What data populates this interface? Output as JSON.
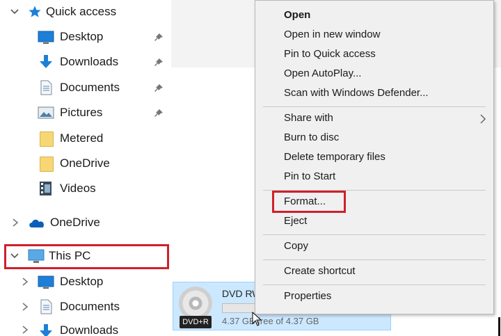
{
  "nav": {
    "quick_access": {
      "label": "Quick access",
      "items": [
        {
          "label": "Desktop",
          "icon": "desktop-icon",
          "pinned": true
        },
        {
          "label": "Downloads",
          "icon": "download-arrow-icon",
          "pinned": true
        },
        {
          "label": "Documents",
          "icon": "document-icon",
          "pinned": true
        },
        {
          "label": "Pictures",
          "icon": "pictures-icon",
          "pinned": true
        },
        {
          "label": "Metered",
          "icon": "folder-icon",
          "pinned": false
        },
        {
          "label": "OneDrive",
          "icon": "folder-icon",
          "pinned": false
        },
        {
          "label": "Videos",
          "icon": "videos-icon",
          "pinned": false
        }
      ]
    },
    "onedrive": {
      "label": "OneDrive",
      "icon": "cloud-icon"
    },
    "this_pc": {
      "label": "This PC",
      "icon": "computer-icon",
      "items": [
        {
          "label": "Desktop",
          "icon": "desktop-icon"
        },
        {
          "label": "Documents",
          "icon": "document-icon"
        },
        {
          "label": "Downloads",
          "icon": "download-arrow-icon"
        }
      ]
    }
  },
  "drive": {
    "name": "DVD RW",
    "badge": "DVD+R",
    "size_text": "4.37 GB free of 4.37 GB",
    "used_fraction": 0.0
  },
  "context_menu": {
    "groups": [
      [
        "Open",
        "Open in new window",
        "Pin to Quick access",
        "Open AutoPlay...",
        "Scan with Windows Defender..."
      ],
      [
        "Share with",
        "Burn to disc",
        "Delete temporary files",
        "Pin to Start"
      ],
      [
        "Format...",
        "Eject"
      ],
      [
        "Copy"
      ],
      [
        "Create shortcut"
      ],
      [
        "Properties"
      ]
    ],
    "submenu_item": "Share with",
    "default_item": "Open"
  },
  "colors": {
    "highlight": "#d0202a",
    "selection": "#cce8ff",
    "menu_bg": "#f0f0f0",
    "accent_blue": "#1e7fd6"
  }
}
